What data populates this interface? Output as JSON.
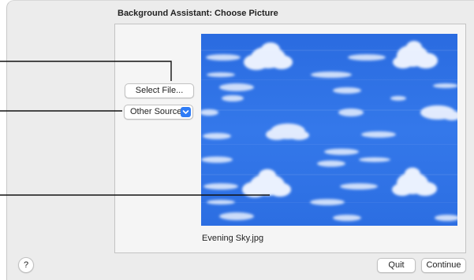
{
  "window": {
    "title": "Background Assistant: Choose Picture"
  },
  "source": {
    "select_file_label": "Select File...",
    "other_sources_label": "Other Sources"
  },
  "preview": {
    "filename": "Evening Sky.jpg",
    "icon": "sky-clouds-image"
  },
  "footer": {
    "help_label": "?",
    "quit_label": "Quit",
    "continue_label": "Continue"
  },
  "colors": {
    "sky": "#2f72e6",
    "accent": "#2f7cf6",
    "callout_line": "#111111"
  }
}
